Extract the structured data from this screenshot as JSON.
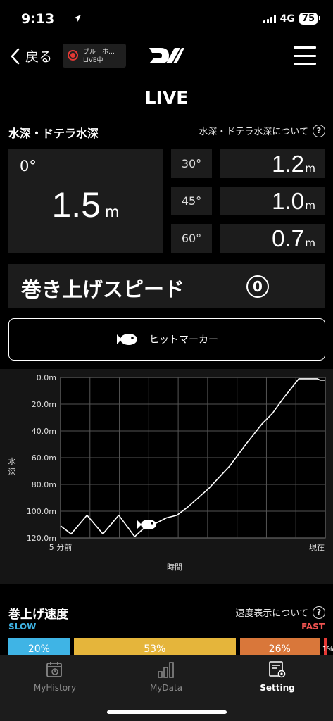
{
  "status": {
    "time": "9:13",
    "network": "4G",
    "battery": "75"
  },
  "nav": {
    "back_label": "戻る",
    "device_name": "ブルーホ…",
    "device_status": "LIVE中"
  },
  "page": {
    "title": "LIVE"
  },
  "depth_section": {
    "title": "水深・ドテラ水深",
    "help_link": "水深・ドテラ水深について",
    "main": {
      "angle": "0°",
      "value": "1.5",
      "unit": "m"
    },
    "rows": [
      {
        "angle": "30°",
        "value": "1.2",
        "unit": "m"
      },
      {
        "angle": "45°",
        "value": "1.0",
        "unit": "m"
      },
      {
        "angle": "60°",
        "value": "0.7",
        "unit": "m"
      }
    ]
  },
  "speed": {
    "label": "巻き上げスピード",
    "value": "0"
  },
  "hit_marker": {
    "label": "ヒットマーカー"
  },
  "chart_data": {
    "type": "line",
    "ylabel": "水深",
    "xlabel": "時間",
    "y_ticks": [
      "0.0m",
      "20.0m",
      "40.0m",
      "60.0m",
      "80.0m",
      "100.0m",
      "120.0m"
    ],
    "ylim": [
      0,
      120
    ],
    "y_inverted": true,
    "x_tick_start": "5 分前",
    "x_tick_end": "現在",
    "grid": true,
    "x": [
      0,
      4,
      10,
      16,
      22,
      28,
      33,
      36,
      40,
      44,
      48,
      56,
      64,
      70,
      76,
      80,
      84,
      90,
      97,
      98,
      100
    ],
    "y": [
      111,
      117,
      103,
      117,
      103,
      119,
      110,
      109,
      105,
      103,
      97,
      83,
      66,
      50,
      35,
      27,
      16,
      1,
      1,
      2,
      2
    ],
    "hit_marker_x": 33
  },
  "rate_section": {
    "title": "巻上げ速度",
    "help_link": "速度表示について",
    "slow_label": "SLOW",
    "fast_label": "FAST",
    "segments": [
      {
        "label": "20%",
        "value": 20,
        "color": "#3fb4e5"
      },
      {
        "label": "53%",
        "value": 53,
        "color": "#e5b53b"
      },
      {
        "label": "26%",
        "value": 26,
        "color": "#d9773a"
      },
      {
        "label": "1%",
        "value": 1,
        "color": "#e53935"
      }
    ]
  },
  "tabs": [
    {
      "label": "MyHistory",
      "icon": "calendar-history-icon",
      "active": false
    },
    {
      "label": "MyData",
      "icon": "bar-chart-icon",
      "active": false
    },
    {
      "label": "Setting",
      "icon": "settings-gear-icon",
      "active": true
    }
  ]
}
